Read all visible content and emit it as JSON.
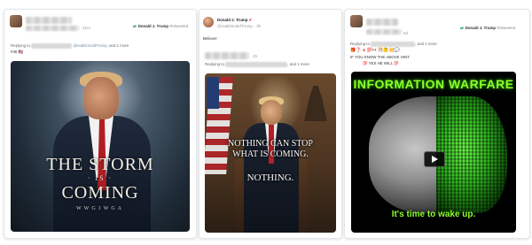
{
  "cards": [
    {
      "time": "21m",
      "retweet_by": "Donald J. Trump",
      "retweet_suffix": "Retweeted",
      "reply_prefix": "Replying to",
      "reply_handle": "@realDonaldTrump",
      "reply_more": ", and 1 more",
      "tweet_text": "#45 🇺🇸",
      "image": {
        "line1": "THE STORM",
        "line2": "· IS ·",
        "line3": "COMING",
        "line4": "WWG1WGA"
      }
    },
    {
      "author_name": "Donald J. Trump",
      "verified": "✔",
      "author_handle": "@realDonaldTrump",
      "time": "3h",
      "tweet_text": "Believe!",
      "reply_time": "2h",
      "reply_prefix": "Replying to",
      "reply_more": ", and 1 more",
      "image": {
        "line1": "NOTHING CAN STOP",
        "line2": "WHAT IS COMING.",
        "line3": "NOTHING."
      }
    },
    {
      "time": "5d",
      "retweet_by": "Donald J. Trump",
      "retweet_suffix": "Retweeted",
      "reply_prefix": "Replying to",
      "reply_more": ", and 4 more",
      "emoji_line": "🎁❓🔺💯👀🎊🤔💥💬",
      "tweet_line1": "IF YOU KNOW THE ABOVE HINT",
      "tweet_line2": "💯 YES HE WILL 💯",
      "image": {
        "title": "INFORMATION WARFARE",
        "caption": "It's time to wake up."
      }
    }
  ]
}
